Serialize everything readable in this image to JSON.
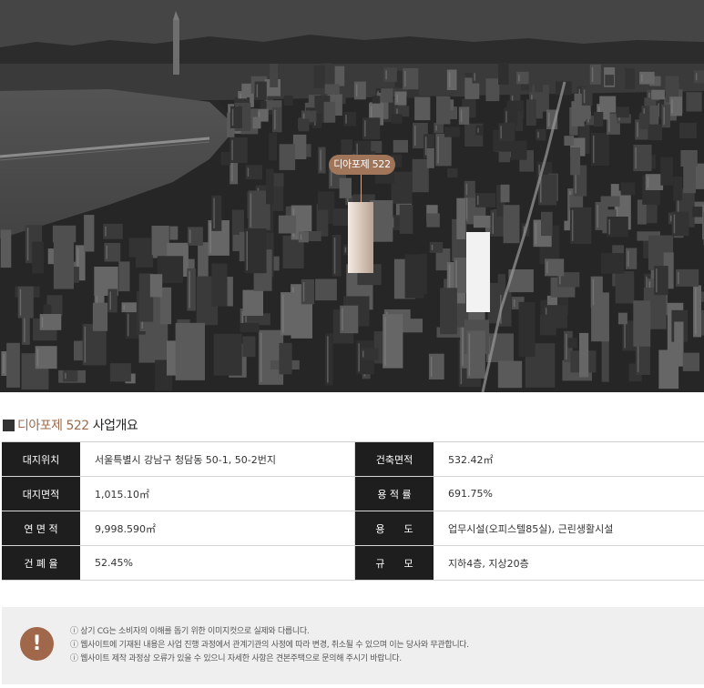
{
  "hero": {
    "image_description_icon": "city-aerial-image",
    "pin_label": "디아포제 522"
  },
  "section": {
    "brand": "디아포제 522",
    "title": "사업개요"
  },
  "overview_rows": [
    {
      "left_label": "대지위치",
      "left_value": "서울특별시 강남구 청담동 50-1, 50-2번지",
      "right_label": "건축면적",
      "right_value": "532.42㎡"
    },
    {
      "left_label": "대지면적",
      "left_value": "1,015.10㎡",
      "right_label": "용 적 률",
      "right_value": "691.75%"
    },
    {
      "left_label": "연 면 적",
      "left_value": "9,998.590㎡",
      "right_label": "용      도",
      "right_value": "업무시설(오피스텔85실), 근린생활시설"
    },
    {
      "left_label": "건 폐 율",
      "left_value": "52.45%",
      "right_label": "규      모",
      "right_value": "지하4층, 지상20층"
    }
  ],
  "notice": {
    "icon": "exclamation-icon",
    "badge_text": "!",
    "lines": [
      "ⓘ 상기 CG는 소비자의 이해를 돕기 위한 이미지컷으로 실제와 다릅니다.",
      "ⓘ 웹사이트에 기재된 내용은 사업 진행 과정에서 관계기관의 사정에 따라 변경, 취소될 수 있으며 이는 당사와 무관합니다.",
      "ⓘ 웹사이트 제작 과정상 오류가 있을 수 있으니 자세한 사항은 견본주택으로 문의해 주시기 바랍니다."
    ]
  },
  "colors": {
    "accent": "#9b6b4d",
    "pin": "#a0755a",
    "label_bg": "#1e1e1e",
    "notice_bg": "#efefef",
    "badge": "#a0674a"
  }
}
